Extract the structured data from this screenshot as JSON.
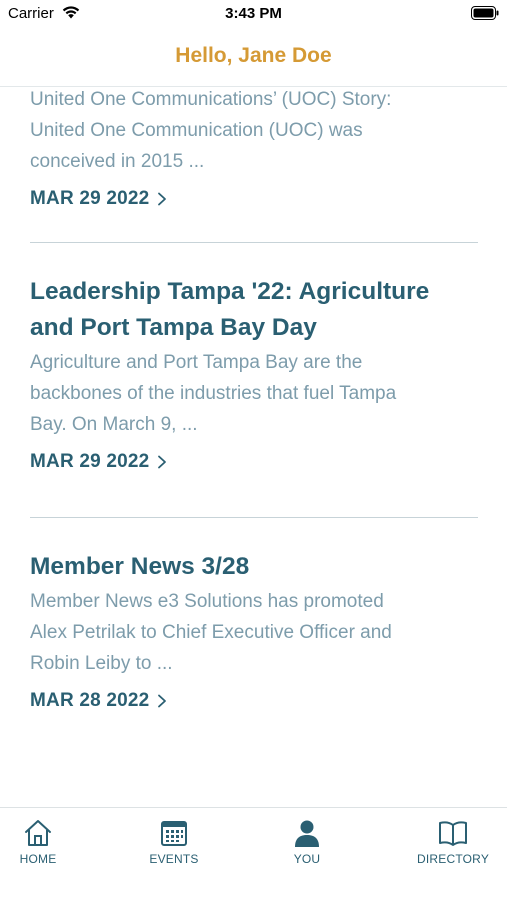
{
  "status_bar": {
    "carrier": "Carrier",
    "time": "3:43 PM"
  },
  "header": {
    "greeting": "Hello, Jane Doe"
  },
  "feed": {
    "articles": [
      {
        "title": "",
        "excerpt_lines": [
          "United One Communications’ (UOC) Story:",
          "United One Communication (UOC) was",
          "conceived in 2015 ..."
        ],
        "date": "MAR 29 2022"
      },
      {
        "title_lines": [
          "Leadership Tampa '22: Agriculture",
          "and Port Tampa Bay Day"
        ],
        "excerpt_lines": [
          "Agriculture and Port Tampa Bay are the",
          "backbones of the industries that fuel Tampa",
          "Bay. On March 9, ..."
        ],
        "date": "MAR 29 2022"
      },
      {
        "title_lines": [
          "Member News 3/28"
        ],
        "excerpt_lines": [
          "Member News e3 Solutions has promoted",
          "Alex Petrilak to Chief Executive Officer and",
          "Robin Leiby to ..."
        ],
        "date": "MAR 28 2022"
      }
    ]
  },
  "tab_bar": {
    "tabs": [
      {
        "label": "HOME",
        "icon": "home-icon"
      },
      {
        "label": "EVENTS",
        "icon": "calendar-icon"
      },
      {
        "label": "YOU",
        "icon": "person-icon"
      },
      {
        "label": "DIRECTORY",
        "icon": "book-icon"
      }
    ]
  },
  "colors": {
    "accent": "#d59a35",
    "primary": "#2a5f72",
    "muted_text": "#7d9cab",
    "divider": "#c7d3d8"
  }
}
